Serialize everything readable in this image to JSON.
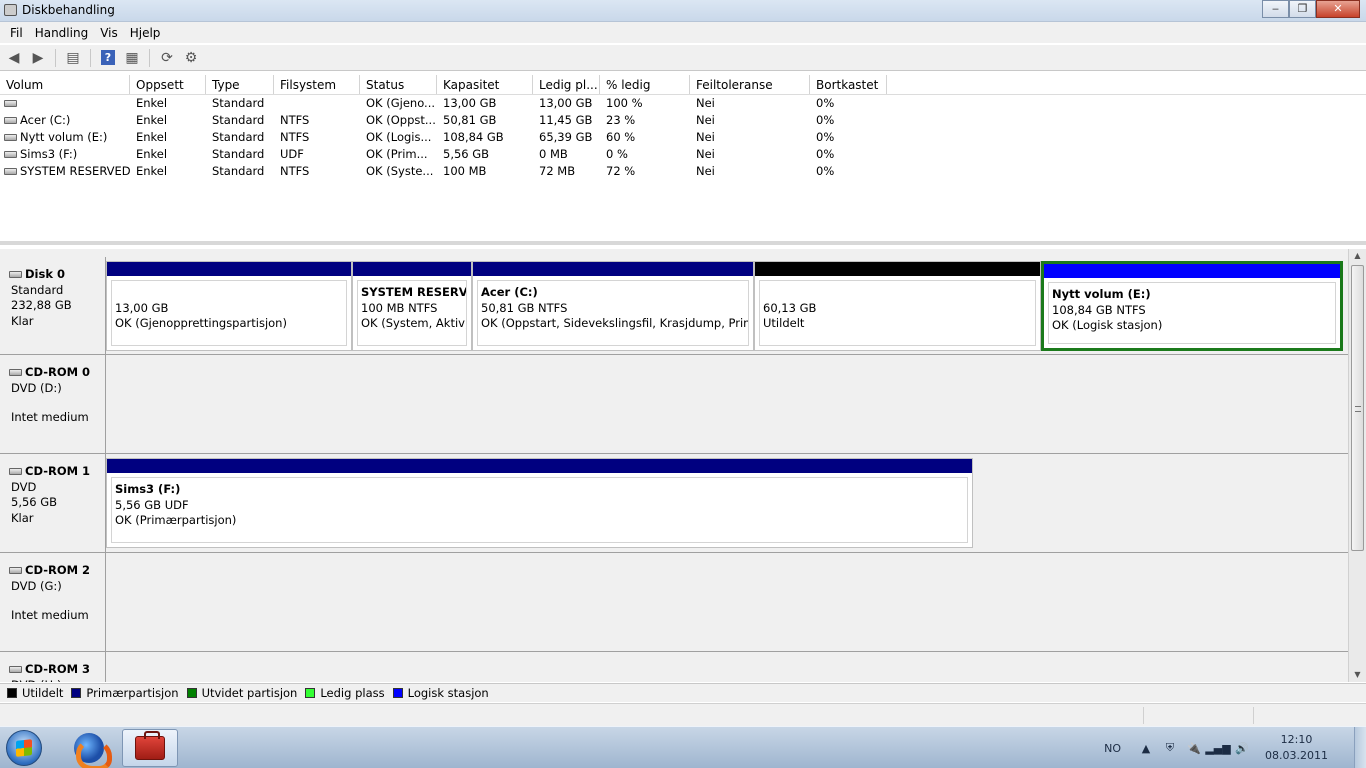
{
  "window": {
    "title": "Diskbehandling",
    "buttons": {
      "minimize": "‒",
      "maximize": "❐",
      "close": "✕"
    }
  },
  "menu": [
    "Fil",
    "Handling",
    "Vis",
    "Hjelp"
  ],
  "toolbar": {
    "help_label": "?"
  },
  "volume_list": {
    "columns": [
      "Volum",
      "Oppsett",
      "Type",
      "Filsystem",
      "Status",
      "Kapasitet",
      "Ledig pl...",
      "% ledig",
      "Feiltoleranse",
      "Bortkastet"
    ],
    "rows": [
      [
        "",
        "Enkel",
        "Standard",
        "",
        "OK (Gjeno...",
        "13,00 GB",
        "13,00 GB",
        "100 %",
        "Nei",
        "0%"
      ],
      [
        "Acer (C:)",
        "Enkel",
        "Standard",
        "NTFS",
        "OK (Oppst...",
        "50,81 GB",
        "11,45 GB",
        "23 %",
        "Nei",
        "0%"
      ],
      [
        "Nytt volum (E:)",
        "Enkel",
        "Standard",
        "NTFS",
        "OK (Logis...",
        "108,84 GB",
        "65,39 GB",
        "60 %",
        "Nei",
        "0%"
      ],
      [
        "Sims3 (F:)",
        "Enkel",
        "Standard",
        "UDF",
        "OK (Prim...",
        "5,56 GB",
        "0 MB",
        "0 %",
        "Nei",
        "0%"
      ],
      [
        "SYSTEM RESERVED",
        "Enkel",
        "Standard",
        "NTFS",
        "OK (Syste...",
        "100 MB",
        "72 MB",
        "72 %",
        "Nei",
        "0%"
      ]
    ]
  },
  "disks": [
    {
      "name": "Disk 0",
      "line1": "Standard",
      "line2": "232,88 GB",
      "line3": "Klar",
      "partitions": [
        {
          "name": "",
          "size": "13,00 GB",
          "status": "OK (Gjenopprettingspartisjon)",
          "kind": "primary"
        },
        {
          "name": "SYSTEM RESERVED",
          "size": "100 MB NTFS",
          "status": "OK (System, Aktiv, P",
          "kind": "primary"
        },
        {
          "name": "Acer  (C:)",
          "size": "50,81 GB NTFS",
          "status": "OK (Oppstart, Sidevekslingsfil, Krasjdump, Primærp",
          "kind": "primary"
        },
        {
          "name": "",
          "size": "60,13 GB",
          "status": "Utildelt",
          "kind": "unallocated"
        },
        {
          "name": "Nytt volum  (E:)",
          "size": "108,84 GB NTFS",
          "status": "OK (Logisk stasjon)",
          "kind": "logical"
        }
      ]
    },
    {
      "name": "CD-ROM 0",
      "line1": "DVD (D:)",
      "line2": "",
      "line3": "Intet medium",
      "partitions": []
    },
    {
      "name": "CD-ROM 1",
      "line1": "DVD",
      "line2": "5,56 GB",
      "line3": "Klar",
      "partitions": [
        {
          "name": "Sims3  (F:)",
          "size": "5,56 GB UDF",
          "status": "OK (Primærpartisjon)",
          "kind": "primary"
        }
      ]
    },
    {
      "name": "CD-ROM 2",
      "line1": "DVD (G:)",
      "line2": "",
      "line3": "Intet medium",
      "partitions": []
    },
    {
      "name": "CD-ROM 3",
      "line1": "DVD (H:)",
      "line2": "",
      "line3": "",
      "partitions": []
    }
  ],
  "legend": [
    {
      "label": "Utildelt",
      "color": "#000000"
    },
    {
      "label": "Primærpartisjon",
      "color": "#000080"
    },
    {
      "label": "Utvidet partisjon",
      "color": "#008000"
    },
    {
      "label": "Ledig plass",
      "color": "#33ff33"
    },
    {
      "label": "Logisk stasjon",
      "color": "#0000ff"
    }
  ],
  "colors": {
    "primary": "#000080",
    "unallocated": "#000000",
    "logical": "#0000ff",
    "extended": "#008000"
  },
  "taskbar": {
    "language": "NO",
    "time": "12:10",
    "date": "08.03.2011"
  }
}
